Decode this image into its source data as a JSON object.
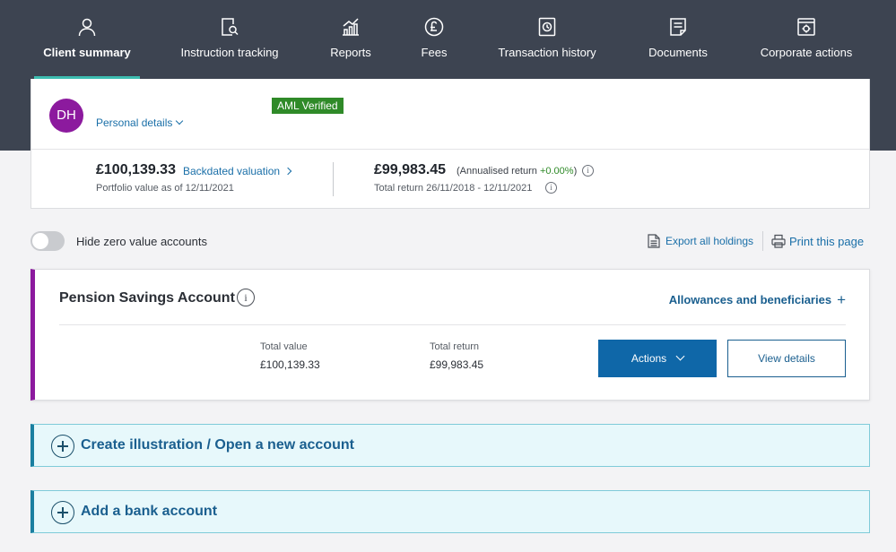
{
  "nav": {
    "items": [
      {
        "label": "Client summary",
        "icon": "person-icon",
        "active": true
      },
      {
        "label": "Instruction tracking",
        "icon": "document-search-icon"
      },
      {
        "label": "Reports",
        "icon": "bar-chart-icon"
      },
      {
        "label": "Fees",
        "icon": "pound-coin-icon"
      },
      {
        "label": "Transaction history",
        "icon": "clock-document-icon"
      },
      {
        "label": "Documents",
        "icon": "document-icon"
      },
      {
        "label": "Corporate actions",
        "icon": "gear-window-icon"
      }
    ]
  },
  "client": {
    "initials": "DH",
    "personal_details_label": "Personal details",
    "aml_badge": "AML Verified",
    "portfolio_value": "£100,139.33",
    "backdated_label": "Backdated valuation",
    "portfolio_value_caption": "Portfolio value as of 12/11/2021",
    "total_return": "£99,983.45",
    "annualised_prefix": "(Annualised return ",
    "annualised_value": "+0.00%",
    "annualised_suffix": ")",
    "total_return_caption": "Total return 26/11/2018 - 12/11/2021",
    "info_glyph": "i"
  },
  "controls": {
    "hide_zero_label": "Hide zero value accounts",
    "hide_zero_on": false,
    "export_label": "Export all holdings",
    "print_label": "Print this page"
  },
  "account": {
    "title": "Pension Savings Account",
    "info_glyph": "i",
    "allowances_label": "Allowances and beneficiaries",
    "plus_glyph": "+",
    "total_value_label": "Total value",
    "total_value": "£100,139.33",
    "total_return_label": "Total return",
    "total_return": "£99,983.45",
    "actions_label": "Actions",
    "view_details_label": "View details"
  },
  "bars": {
    "create_label": "Create illustration / Open a new account",
    "bank_label": "Add a bank account"
  },
  "colors": {
    "nav_bg": "#3d4451",
    "active_underline": "#3dbdb0",
    "avatar": "#8c1a9e",
    "aml_green": "#2f8a28",
    "link_blue": "#1a6fa8",
    "primary_button": "#0f67a8",
    "bar_bg": "#e7f8fb"
  }
}
